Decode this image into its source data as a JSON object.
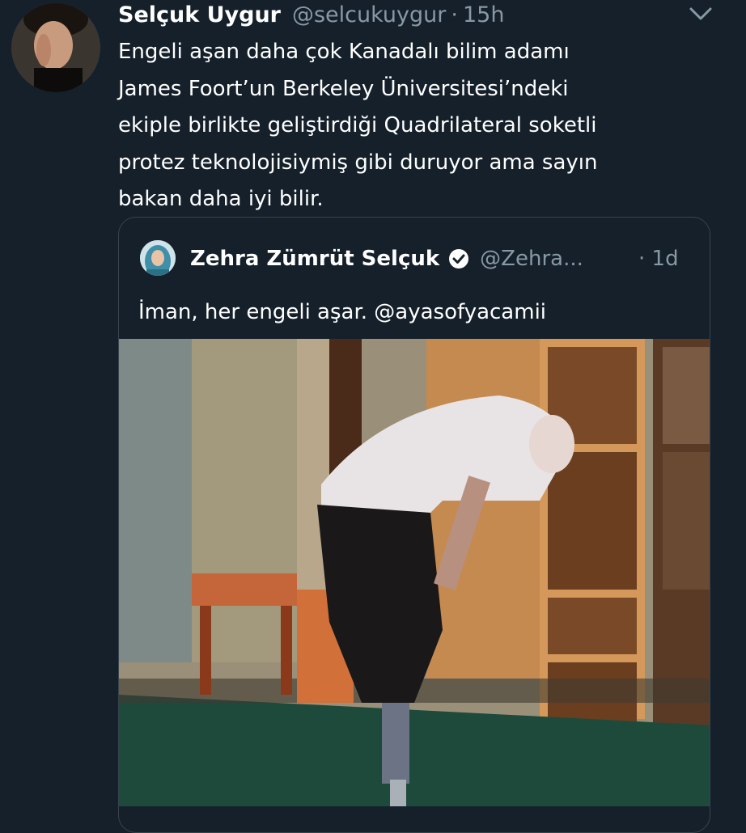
{
  "tweet": {
    "author_name": "Selçuk Uygur",
    "handle": "@selcukuygur",
    "separator": "·",
    "time": "15h",
    "text_lines": [
      "Engeli aşan daha çok Kanadalı bilim adamı",
      "James Foort’un Berkeley Üniversitesi’ndeki",
      "ekiple birlikte geliştirdiği Quadrilateral soketli",
      "protez teknolojisiymiş gibi duruyor ama sayın",
      "bakan daha iyi bilir."
    ]
  },
  "quoted_tweet": {
    "author_name": "Zehra Zümrüt Selçuk",
    "handle": "@Zehra...",
    "time": "· 1d",
    "text": "İman, her engeli aşar. @ayasofyacamii",
    "verified": true
  },
  "icons": {
    "menu": "chevron-down-icon",
    "verified": "verified-badge-icon"
  },
  "colors": {
    "background": "#15202b",
    "secondary_text": "#8899a6",
    "border": "#38444d"
  }
}
